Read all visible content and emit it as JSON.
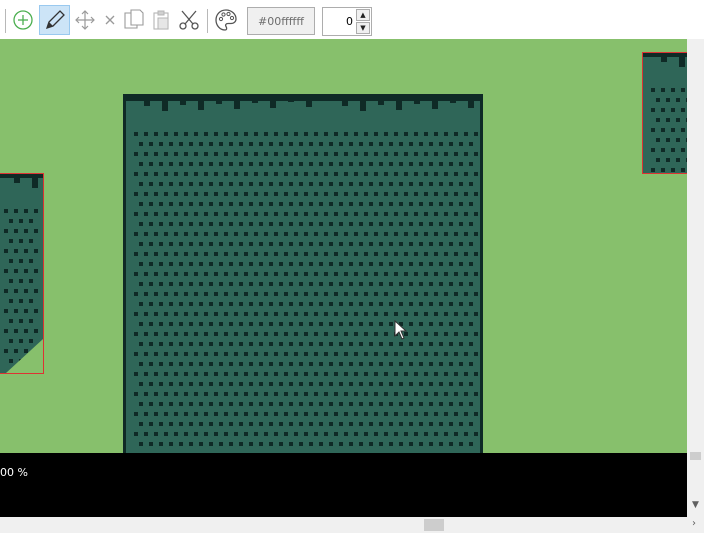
{
  "toolbar": {
    "icons": [
      "add-frame-icon",
      "pen-icon",
      "move-icon",
      "delete-icon",
      "copy-icon",
      "paste-icon",
      "cut-icon",
      "palette-icon"
    ],
    "color_value": "#00ffffff",
    "number_value": "0",
    "active_tool": "pen"
  },
  "canvas": {
    "background_color": "#87c06c",
    "tile_color": "#2f6658",
    "dot_color": "#0f2a26"
  },
  "status": {
    "zoom_text": "00 %"
  }
}
